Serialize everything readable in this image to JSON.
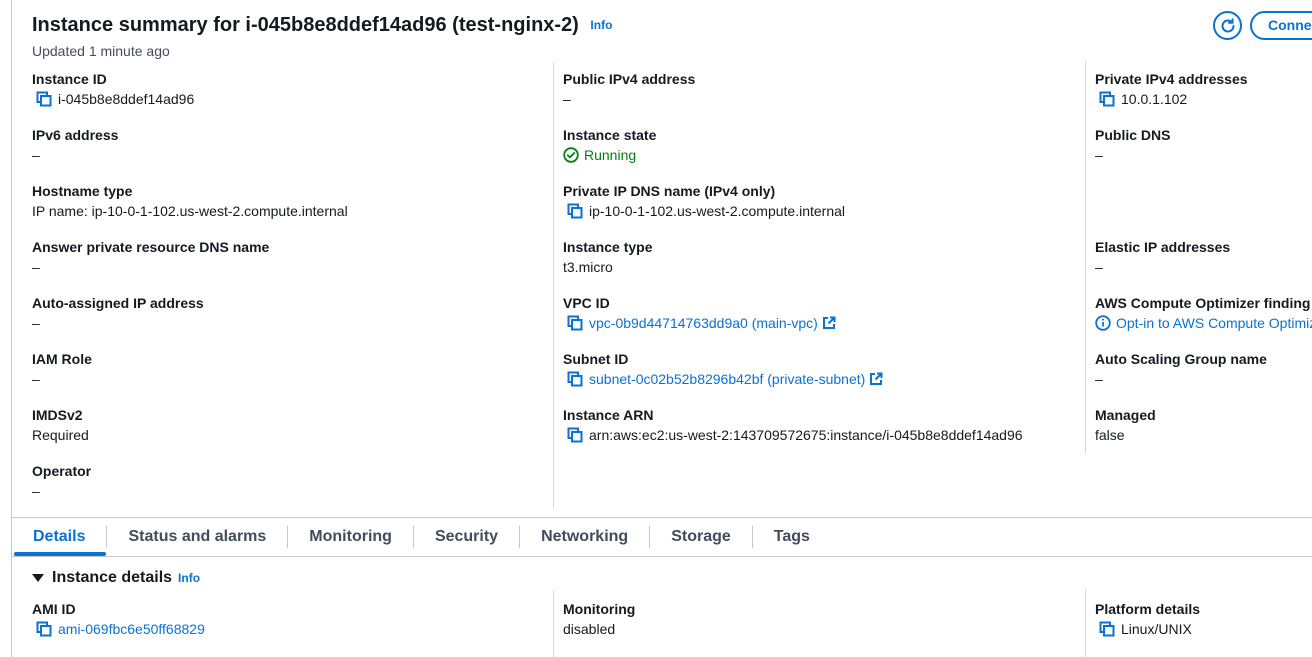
{
  "header": {
    "title": "Instance summary for i-045b8e8ddef14ad96 (test-nginx-2)",
    "info": "Info",
    "updated": "Updated 1 minute ago",
    "connect_label": "Connect"
  },
  "summary": {
    "col1": [
      {
        "label": "Instance ID",
        "value": "i-045b8e8ddef14ad96",
        "copy": true
      },
      {
        "label": "IPv6 address",
        "value": "–"
      },
      {
        "label": "Hostname type",
        "value": "IP name: ip-10-0-1-102.us-west-2.compute.internal"
      },
      {
        "label": "Answer private resource DNS name",
        "value": "–"
      },
      {
        "label": "Auto-assigned IP address",
        "value": "–"
      },
      {
        "label": "IAM Role",
        "value": "–"
      },
      {
        "label": "IMDSv2",
        "value": "Required"
      },
      {
        "label": "Operator",
        "value": "–"
      }
    ],
    "col2": [
      {
        "label": "Public IPv4 address",
        "value": "–"
      },
      {
        "label": "Instance state",
        "value": "Running",
        "status": "success-icon"
      },
      {
        "label": "Private IP DNS name (IPv4 only)",
        "value": "ip-10-0-1-102.us-west-2.compute.internal",
        "copy": true
      },
      {
        "label": "Instance type",
        "value": "t3.micro"
      },
      {
        "label": "VPC ID",
        "value": "vpc-0b9d44714763dd9a0 (main-vpc)",
        "copy": true,
        "link": true,
        "external": true
      },
      {
        "label": "Subnet ID",
        "value": "subnet-0c02b52b8296b42bf (private-subnet)",
        "copy": true,
        "link": true,
        "external": true
      },
      {
        "label": "Instance ARN",
        "value": "arn:aws:ec2:us-west-2:143709572675:instance/i-045b8e8ddef14ad96",
        "copy": true
      }
    ],
    "col3": [
      {
        "label": "Private IPv4 addresses",
        "value": "10.0.1.102",
        "copy": true
      },
      {
        "label": "Public DNS",
        "value": "–"
      },
      {
        "label": "",
        "value": ""
      },
      {
        "label": "Elastic IP addresses",
        "value": "–"
      },
      {
        "label": "AWS Compute Optimizer finding",
        "value": "Opt-in to AWS Compute Optimizer for recommendations.",
        "link": true,
        "info_icon": true
      },
      {
        "label": "Auto Scaling Group name",
        "value": "–"
      },
      {
        "label": "Managed",
        "value": "false"
      }
    ]
  },
  "tabs": [
    "Details",
    "Status and alarms",
    "Monitoring",
    "Security",
    "Networking",
    "Storage",
    "Tags"
  ],
  "active_tab": "Details",
  "details": {
    "title": "Instance details",
    "info": "Info",
    "fields": [
      {
        "label": "AMI ID",
        "value": "ami-069fbc6e50ff68829",
        "copy": true,
        "link": true
      },
      {
        "label": "Monitoring",
        "value": "disabled"
      },
      {
        "label": "Platform details",
        "value": "Linux/UNIX",
        "copy": true
      }
    ]
  },
  "colors": {
    "link": "#0972d3",
    "success": "#037f0c",
    "text": "#16191f",
    "border": "#c6c6cd"
  }
}
